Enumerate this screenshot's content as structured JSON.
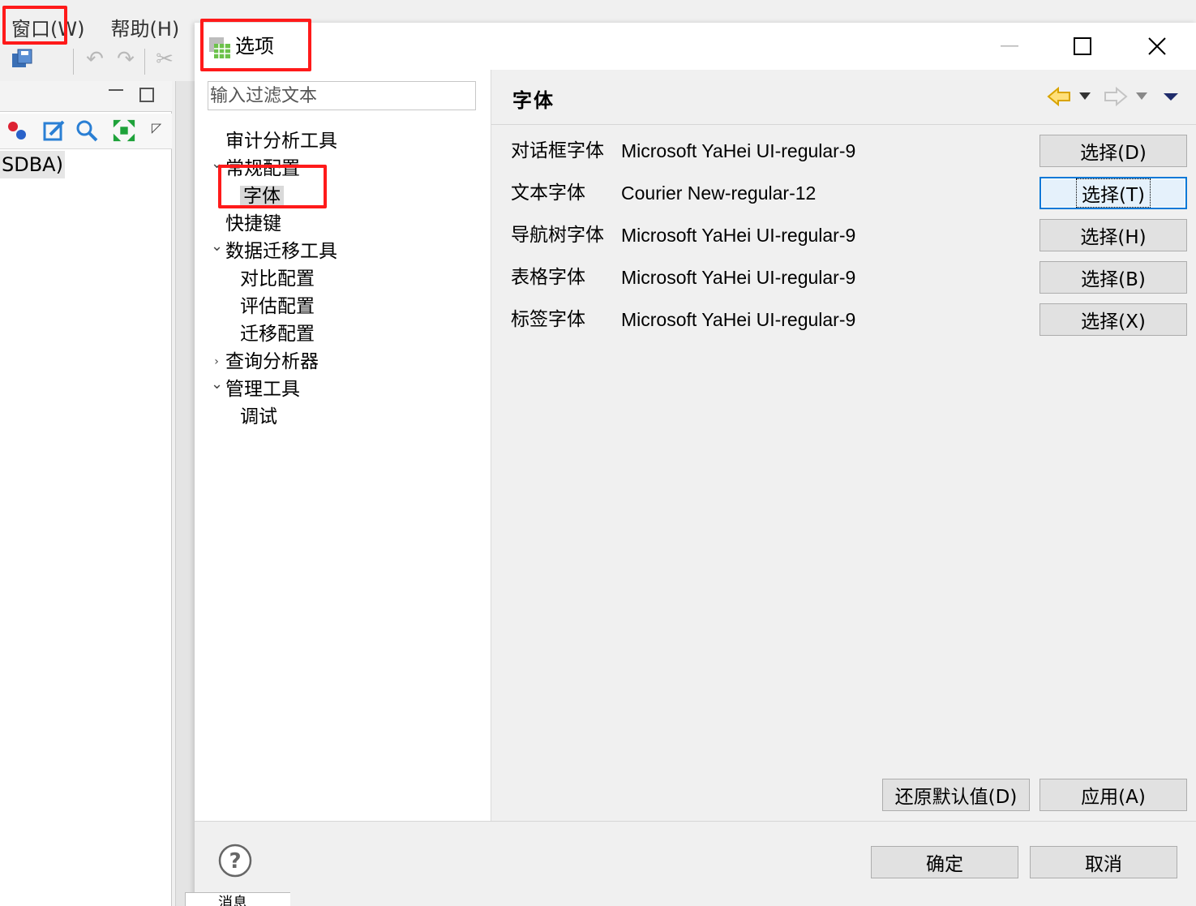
{
  "ide": {
    "menu": [
      {
        "label": "窗口(W)"
      },
      {
        "label": "帮助(H)"
      }
    ],
    "left_panel_node": "SDBA)"
  },
  "dialog": {
    "title": "选项",
    "filter": {
      "placeholder": "输入过滤文本",
      "value": ""
    },
    "tree": [
      {
        "label": "审计分析工具",
        "level": 0,
        "expand": "none"
      },
      {
        "label": "常规配置",
        "level": 0,
        "expand": "expanded"
      },
      {
        "label": "字体",
        "level": 1,
        "expand": "none",
        "selected": true
      },
      {
        "label": "快捷键",
        "level": 0,
        "expand": "none"
      },
      {
        "label": "数据迁移工具",
        "level": 0,
        "expand": "expanded"
      },
      {
        "label": "对比配置",
        "level": 1,
        "expand": "none"
      },
      {
        "label": "评估配置",
        "level": 1,
        "expand": "none"
      },
      {
        "label": "迁移配置",
        "level": 1,
        "expand": "none"
      },
      {
        "label": "查询分析器",
        "level": 0,
        "expand": "collapsed"
      },
      {
        "label": "管理工具",
        "level": 0,
        "expand": "expanded"
      },
      {
        "label": "调试",
        "level": 1,
        "expand": "none"
      }
    ],
    "page": {
      "title": "字体",
      "rows": [
        {
          "label": "对话框字体",
          "value": "Microsoft YaHei UI-regular-9",
          "button": "选择(D)"
        },
        {
          "label": "文本字体",
          "value": "Courier New-regular-12",
          "button": "选择(T)"
        },
        {
          "label": "导航树字体",
          "value": "Microsoft YaHei UI-regular-9",
          "button": "选择(H)"
        },
        {
          "label": "表格字体",
          "value": "Microsoft YaHei UI-regular-9",
          "button": "选择(B)"
        },
        {
          "label": "标签字体",
          "value": "Microsoft YaHei UI-regular-9",
          "button": "选择(X)"
        }
      ],
      "restore_label": "还原默认值(D)",
      "apply_label": "应用(A)"
    },
    "ok_label": "确定",
    "cancel_label": "取消"
  },
  "status_tab": "消息",
  "colors": {
    "highlight_box": "#ff1a1a",
    "focus": "#0078d7",
    "nav_arrow": "#e8b200"
  }
}
